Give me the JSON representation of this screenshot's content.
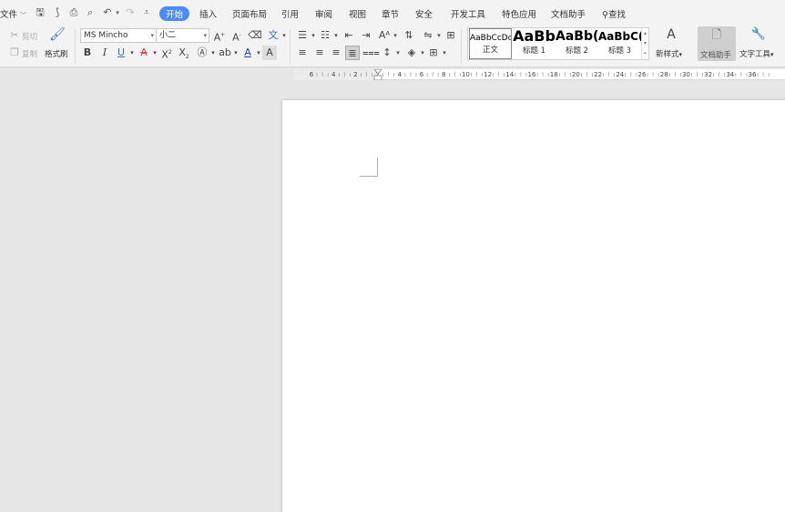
{
  "menubar": {
    "file": "文件",
    "tabs": [
      {
        "label": "开始",
        "active": true
      },
      {
        "label": "插入"
      },
      {
        "label": "页面布局"
      },
      {
        "label": "引用"
      },
      {
        "label": "审阅"
      },
      {
        "label": "视图"
      },
      {
        "label": "章节"
      },
      {
        "label": "安全"
      },
      {
        "label": "开发工具"
      },
      {
        "label": "特色应用"
      },
      {
        "label": "文档助手"
      }
    ],
    "search_label": "查找",
    "accent_color": "#4c8bf5"
  },
  "clipboard": {
    "cut_label": "剪切",
    "copy_label": "复制",
    "format_painter_label": "格式刷"
  },
  "font": {
    "family_value": "MS Mincho",
    "size_value": "小二"
  },
  "styles": {
    "items": [
      {
        "preview": "AaBbCcDd",
        "name": "正文"
      },
      {
        "preview": "AaBb",
        "name": "标题 1"
      },
      {
        "preview": "AaBb(",
        "name": "标题 2"
      },
      {
        "preview": "AaBbC(",
        "name": "标题 3"
      }
    ],
    "new_style_label": "新样式",
    "assistant_label": "文档助手",
    "text_tools_label": "文字工具"
  },
  "ruler": {
    "labels": [
      "6",
      "4",
      "2",
      "2",
      "4",
      "6",
      "8",
      "10",
      "12",
      "14",
      "16",
      "18",
      "20",
      "22",
      "24",
      "26",
      "28",
      "30",
      "32",
      "34",
      "36"
    ]
  },
  "icons": {
    "save": "save-icon",
    "undo": "undo-icon",
    "redo": "redo-icon",
    "print": "print-icon",
    "preview": "print-preview-icon",
    "bold": "bold-icon",
    "italic": "italic-icon",
    "underline": "underline-icon"
  }
}
